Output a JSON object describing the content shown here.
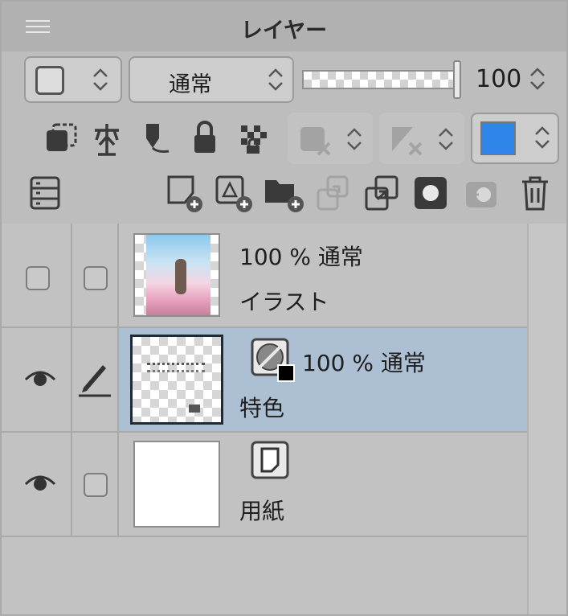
{
  "panel": {
    "title": "レイヤー"
  },
  "toolbar1": {
    "blend_mode": "通常",
    "opacity": "100"
  },
  "layers": [
    {
      "opacity_mode": "100 % 通常",
      "name": "イラスト",
      "visible": false,
      "editing": false
    },
    {
      "opacity_mode": "100 % 通常",
      "name": "特色",
      "visible": true,
      "editing": true,
      "selected": true
    },
    {
      "opacity_mode": "",
      "name": "用紙",
      "visible": true,
      "editing": false
    }
  ],
  "colors": {
    "selected_row": "#adc0d3",
    "color_swatch": "#2f86e8",
    "panel_bg": "#bdbdbd"
  },
  "icons": [
    "menu-icon",
    "clip-icon",
    "reference-icon",
    "lock-transparent-icon",
    "lock-icon",
    "lock-pixel-icon",
    "mask-disable-icon",
    "ruler-disable-icon",
    "layer-list-icon",
    "new-raster-layer-icon",
    "new-vector-layer-icon",
    "new-folder-icon",
    "transfer-down-icon",
    "merge-down-icon",
    "mask-icon",
    "copy-icon",
    "trash-icon",
    "eye-icon",
    "pen-icon",
    "color-tone-icon",
    "paper-icon"
  ]
}
